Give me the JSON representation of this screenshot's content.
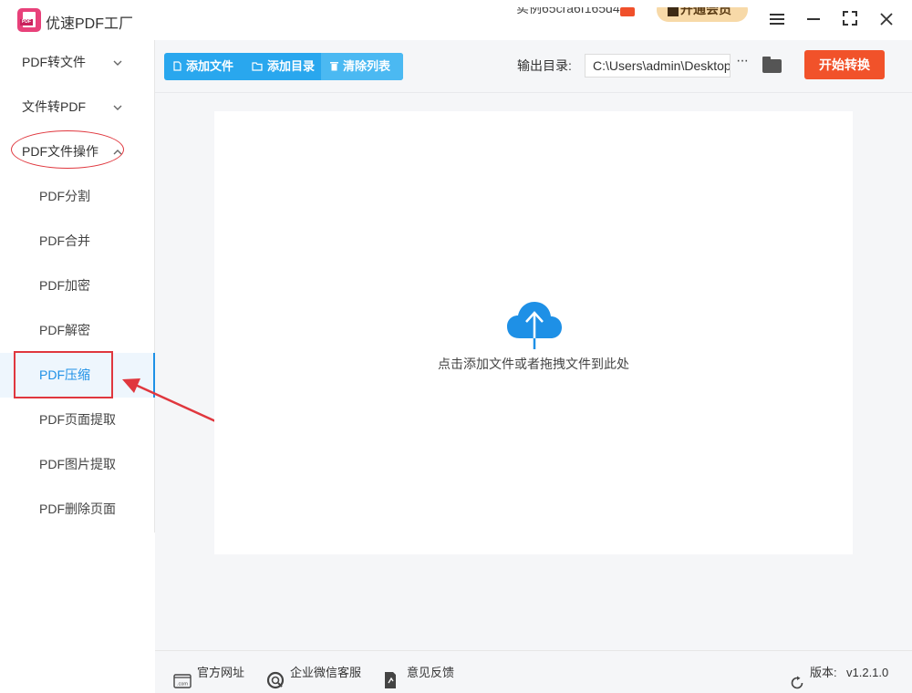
{
  "app": {
    "title": "优速PDF工厂",
    "logo_tag": "PDF",
    "user_id": "实例65cra6f165d4",
    "member_label": "开通会员"
  },
  "sidebar": {
    "categories": [
      {
        "label": "PDF转文件",
        "expanded": false
      },
      {
        "label": "文件转PDF",
        "expanded": false
      },
      {
        "label": "PDF文件操作",
        "expanded": true
      }
    ],
    "sub_items": [
      {
        "label": "PDF分割"
      },
      {
        "label": "PDF合并"
      },
      {
        "label": "PDF加密"
      },
      {
        "label": "PDF解密"
      },
      {
        "label": "PDF压缩",
        "active": true
      },
      {
        "label": "PDF页面提取"
      },
      {
        "label": "PDF图片提取"
      },
      {
        "label": "PDF删除页面"
      }
    ]
  },
  "toolbar": {
    "add_file": "添加文件",
    "add_folder": "添加目录",
    "clear_list": "清除列表",
    "output_label": "输出目录:",
    "output_path": "C:\\Users\\admin\\Desktop",
    "more": "···",
    "start": "开始转换"
  },
  "main": {
    "drop_hint": "点击添加文件或者拖拽文件到此处"
  },
  "footer": {
    "website": "官方网址",
    "wechat": "企业微信客服",
    "feedback": "意见反馈",
    "version_label": "版本:",
    "version": "v1.2.1.0"
  },
  "colors": {
    "accent": "#29a7ee",
    "start": "#f1522a",
    "annotation": "#e0373e",
    "active_text": "#1e90e6"
  }
}
